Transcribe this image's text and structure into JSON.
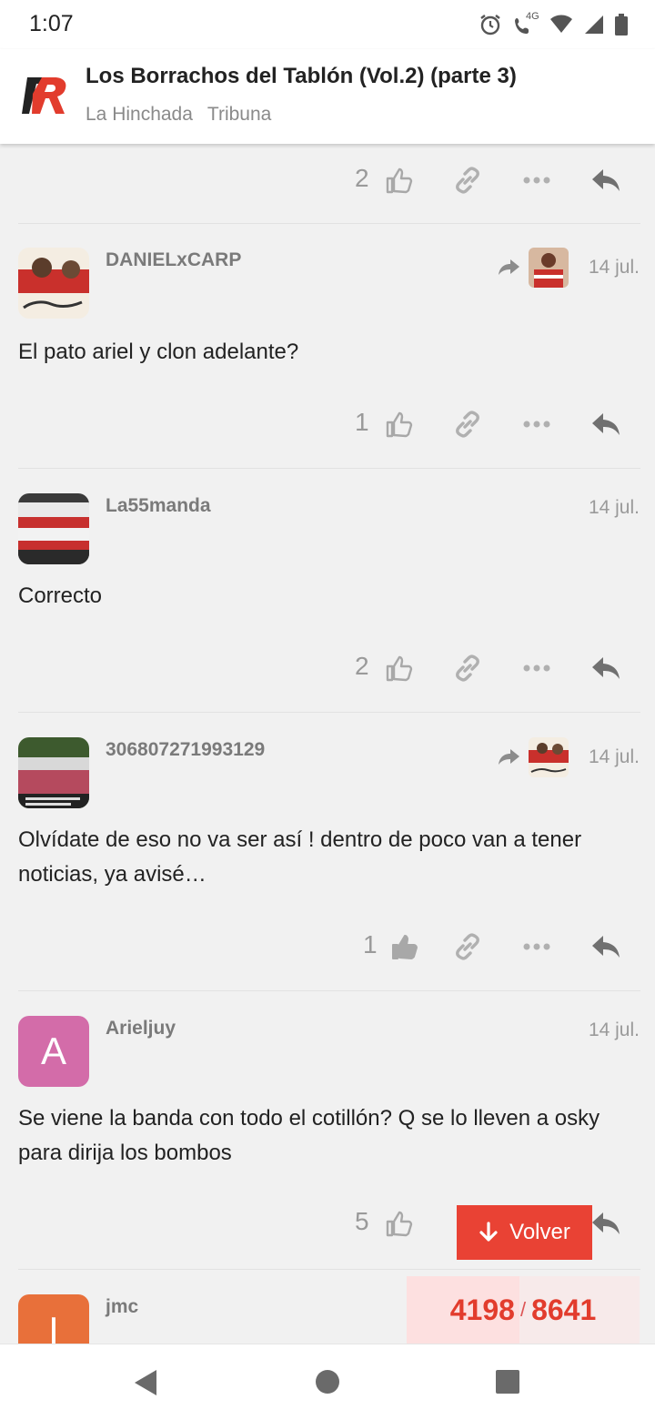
{
  "status_bar": {
    "time": "1:07",
    "network": "4G",
    "icons": [
      "alarm-icon",
      "volte-call-icon",
      "wifi-icon",
      "cell-signal-icon",
      "battery-icon"
    ]
  },
  "header": {
    "title": "Los Borrachos del Tablón (Vol.2) (parte 3)",
    "breadcrumb": [
      "La Hinchada",
      "Tribuna"
    ],
    "accent_color": "#e23c2d"
  },
  "posts": [
    {
      "like_count": "2",
      "liked": false
    },
    {
      "username": "DANIELxCARP",
      "date": "14 jul.",
      "text": "El pato ariel y clon adelante?",
      "is_reply": true,
      "like_count": "1",
      "liked": false
    },
    {
      "username": "La55manda",
      "date": "14 jul.",
      "text": "Correcto",
      "is_reply": false,
      "like_count": "2",
      "liked": false
    },
    {
      "username": "306807271993129",
      "date": "14 jul.",
      "text": "Olvídate de eso no va ser así ! dentro de poco van a tener noticias, ya avisé…",
      "is_reply": true,
      "like_count": "1",
      "liked": true
    },
    {
      "username": "Arieljuy",
      "date": "14 jul.",
      "text": "Se viene la banda con todo el cotillón? Q se lo lleven a osky para dirija los bombos",
      "is_reply": false,
      "avatar_letter": "A",
      "avatar_color": "#d36ca9",
      "like_count": "5",
      "liked": false
    },
    {
      "username": "jmc",
      "avatar_letter": "I",
      "avatar_color": "#e8703a"
    }
  ],
  "volver_label": "Volver",
  "progress": {
    "current": "4198",
    "total": "8641",
    "fraction": 0.486
  }
}
